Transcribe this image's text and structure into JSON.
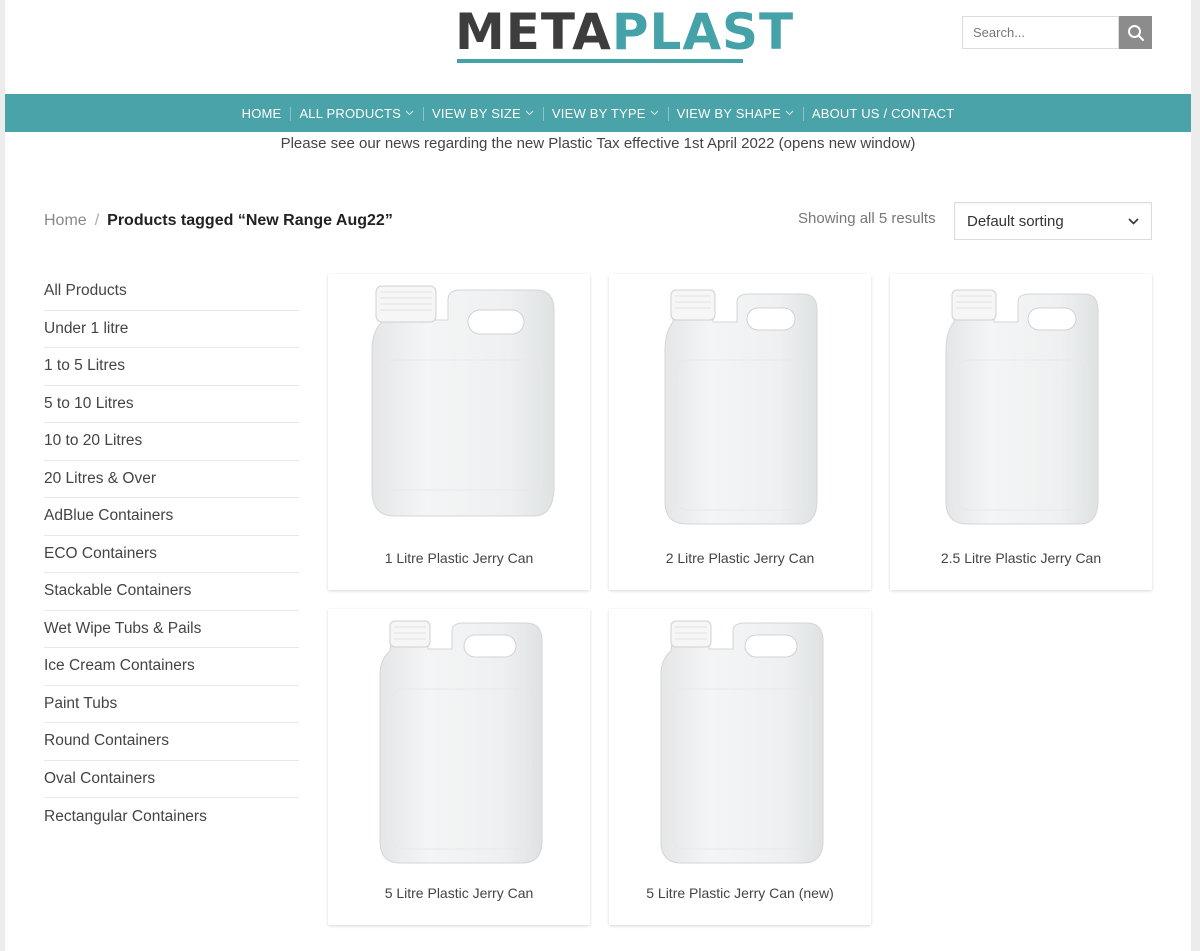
{
  "header": {
    "logo": {
      "part1": "META",
      "part2": "PLAST"
    },
    "search": {
      "placeholder": "Search..."
    }
  },
  "nav": {
    "items": [
      {
        "label": "HOME"
      },
      {
        "label": "ALL PRODUCTS"
      },
      {
        "label": "VIEW BY SIZE"
      },
      {
        "label": "VIEW BY TYPE"
      },
      {
        "label": "VIEW BY SHAPE"
      },
      {
        "label": "ABOUT US / CONTACT"
      }
    ]
  },
  "notice": "Please see our news regarding the new Plastic Tax effective 1st April 2022 (opens new window)",
  "breadcrumb": {
    "home": "Home",
    "separator": "/",
    "current": "Products tagged “New Range Aug22”"
  },
  "results": "Showing all 5 results",
  "sort": {
    "selected": "Default sorting"
  },
  "sidebar": {
    "items": [
      {
        "label": "All Products"
      },
      {
        "label": "Under 1 litre"
      },
      {
        "label": "1 to 5 Litres"
      },
      {
        "label": "5 to 10 Litres"
      },
      {
        "label": "10 to 20 Litres"
      },
      {
        "label": "20 Litres & Over"
      },
      {
        "label": "AdBlue Containers"
      },
      {
        "label": "ECO Containers"
      },
      {
        "label": "Stackable Containers"
      },
      {
        "label": "Wet Wipe Tubs & Pails"
      },
      {
        "label": "Ice Cream Containers"
      },
      {
        "label": "Paint Tubs"
      },
      {
        "label": "Round Containers"
      },
      {
        "label": "Oval Containers"
      },
      {
        "label": "Rectangular Containers"
      }
    ]
  },
  "products": [
    {
      "name": "1 Litre Plastic Jerry Can"
    },
    {
      "name": "2 Litre Plastic Jerry Can"
    },
    {
      "name": "2.5 Litre Plastic Jerry Can"
    },
    {
      "name": "5 Litre Plastic Jerry Can"
    },
    {
      "name": "5 Litre Plastic Jerry Can (new)"
    }
  ],
  "colors": {
    "brand_teal": "#4aa3a8",
    "logo_dark": "#3d3d3d"
  }
}
